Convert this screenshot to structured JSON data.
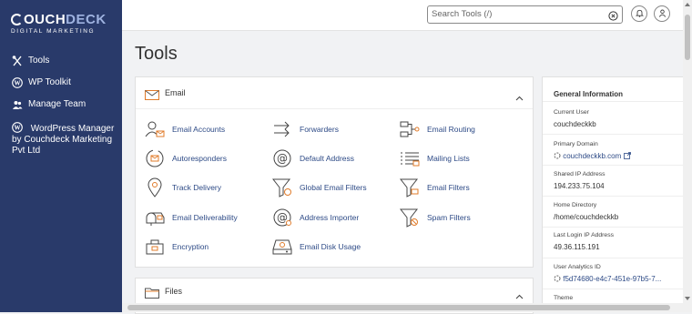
{
  "brand": {
    "name_part1": "OUCH",
    "name_part2": "DECK",
    "tagline": "DIGITAL MARKETING"
  },
  "sidebar": {
    "items": [
      {
        "label": "Tools",
        "icon": "tools-icon"
      },
      {
        "label": "WP Toolkit",
        "icon": "wordpress-icon"
      },
      {
        "label": "Manage Team",
        "icon": "users-icon"
      },
      {
        "label": "WordPress Manager by Couchdeck Marketing Pvt Ltd",
        "icon": "wordpress-icon"
      }
    ]
  },
  "header": {
    "search_placeholder": "Search Tools (/)"
  },
  "page": {
    "title": "Tools"
  },
  "email_section": {
    "title": "Email",
    "tools": [
      {
        "label": "Email Accounts",
        "icon": "user-mail-icon"
      },
      {
        "label": "Forwarders",
        "icon": "forward-arrows-icon"
      },
      {
        "label": "Email Routing",
        "icon": "routing-icon"
      },
      {
        "label": "Autoresponders",
        "icon": "autoresponder-icon"
      },
      {
        "label": "Default Address",
        "icon": "at-sign-icon"
      },
      {
        "label": "Mailing Lists",
        "icon": "list-icon"
      },
      {
        "label": "Track Delivery",
        "icon": "location-pin-icon"
      },
      {
        "label": "Global Email Filters",
        "icon": "funnel-icon"
      },
      {
        "label": "Email Filters",
        "icon": "funnel-icon"
      },
      {
        "label": "Email Deliverability",
        "icon": "mailbox-icon"
      },
      {
        "label": "Address Importer",
        "icon": "at-sign-icon"
      },
      {
        "label": "Spam Filters",
        "icon": "funnel-icon"
      },
      {
        "label": "Encryption",
        "icon": "encryption-icon"
      },
      {
        "label": "Email Disk Usage",
        "icon": "disk-icon"
      }
    ]
  },
  "files_section": {
    "title": "Files"
  },
  "general_info": {
    "title": "General Information",
    "fields": [
      {
        "label": "Current User",
        "value": "couchdeckkb"
      },
      {
        "label": "Primary Domain",
        "value": "couchdeckkb.com"
      },
      {
        "label": "Shared IP Address",
        "value": "194.233.75.104"
      },
      {
        "label": "Home Directory",
        "value": "/home/couchdeckkb"
      },
      {
        "label": "Last Login IP Address",
        "value": "49.36.115.191"
      },
      {
        "label": "User Analytics ID",
        "value": "f5d74680-e4c7-451e-97b5-7..."
      },
      {
        "label": "Theme",
        "value": ""
      }
    ]
  },
  "colors": {
    "sidebar_bg": "#293a6a",
    "link": "#2d4a86",
    "accent_orange": "#e07b2a"
  }
}
